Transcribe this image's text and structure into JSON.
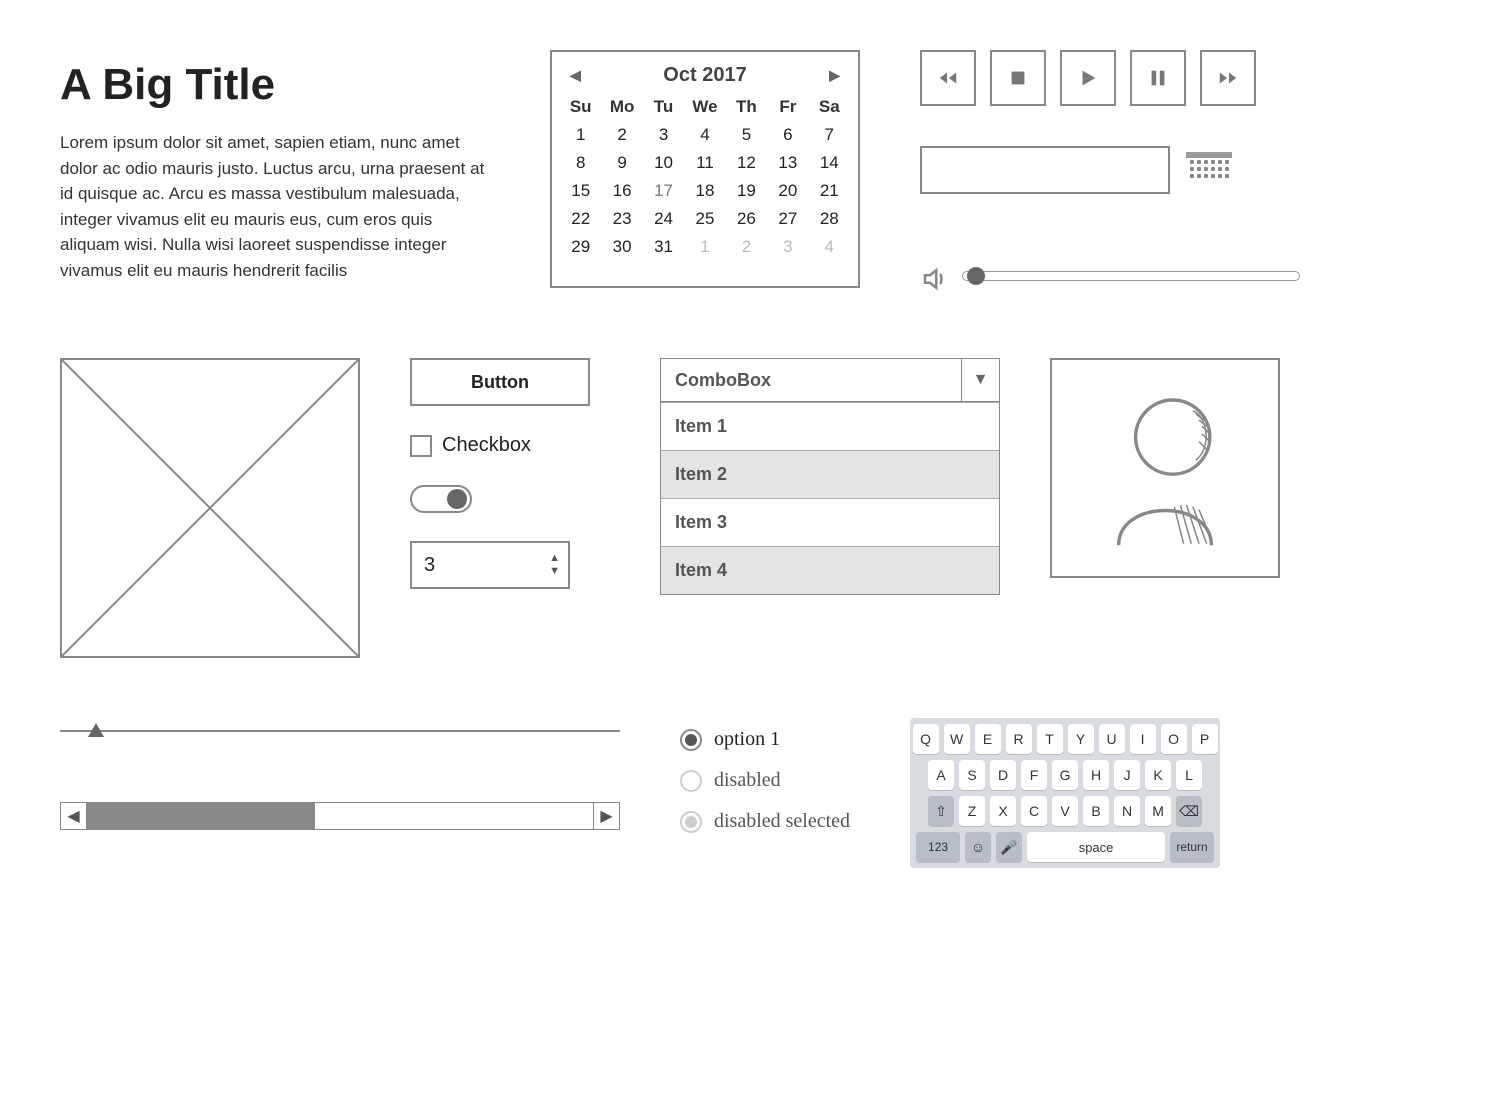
{
  "title": "A Big Title",
  "paragraph": "Lorem ipsum dolor sit amet, sapien etiam, nunc amet dolor ac odio mauris justo. Luctus arcu, urna praesent at id quisque ac. Arcu es massa vestibulum malesuada, integer vivamus elit eu mauris eus, cum eros quis aliquam wisi. Nulla wisi laoreet suspendisse integer vivamus elit eu mauris hendrerit facilis",
  "calendar": {
    "month_label": "Oct  2017",
    "dow": [
      "Su",
      "Mo",
      "Tu",
      "We",
      "Th",
      "Fr",
      "Sa"
    ],
    "days": [
      {
        "n": "1"
      },
      {
        "n": "2"
      },
      {
        "n": "3"
      },
      {
        "n": "4"
      },
      {
        "n": "5"
      },
      {
        "n": "6"
      },
      {
        "n": "7"
      },
      {
        "n": "8"
      },
      {
        "n": "9"
      },
      {
        "n": "10"
      },
      {
        "n": "11"
      },
      {
        "n": "12"
      },
      {
        "n": "13"
      },
      {
        "n": "14"
      },
      {
        "n": "15"
      },
      {
        "n": "16"
      },
      {
        "n": "17",
        "today": true
      },
      {
        "n": "18"
      },
      {
        "n": "19"
      },
      {
        "n": "20"
      },
      {
        "n": "21"
      },
      {
        "n": "22"
      },
      {
        "n": "23"
      },
      {
        "n": "24"
      },
      {
        "n": "25"
      },
      {
        "n": "26"
      },
      {
        "n": "27"
      },
      {
        "n": "28"
      },
      {
        "n": "29"
      },
      {
        "n": "30"
      },
      {
        "n": "31"
      },
      {
        "n": "1",
        "other": true
      },
      {
        "n": "2",
        "other": true
      },
      {
        "n": "3",
        "other": true
      },
      {
        "n": "4",
        "other": true
      }
    ]
  },
  "button_label": "Button",
  "checkbox_label": "Checkbox",
  "stepper_value": "3",
  "combobox": {
    "label": "ComboBox",
    "items": [
      "Item 1",
      "Item 2",
      "Item 3",
      "Item 4"
    ]
  },
  "radios": {
    "opt1": "option 1",
    "opt2": "disabled",
    "opt3": "disabled selected"
  },
  "keyboard": {
    "row1": [
      "Q",
      "W",
      "E",
      "R",
      "T",
      "Y",
      "U",
      "I",
      "O",
      "P"
    ],
    "row2": [
      "A",
      "S",
      "D",
      "F",
      "G",
      "H",
      "J",
      "K",
      "L"
    ],
    "row3": [
      "Z",
      "X",
      "C",
      "V",
      "B",
      "N",
      "M"
    ],
    "num_key": "123",
    "space_label": "space",
    "return_label": "return"
  }
}
